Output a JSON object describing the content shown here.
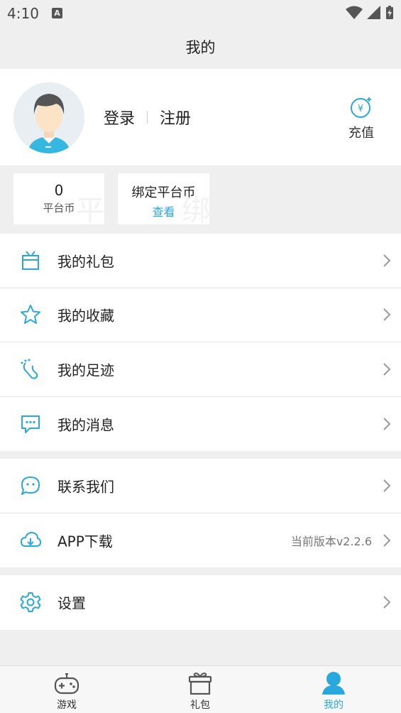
{
  "status_bar": {
    "time": "4:10",
    "notif_letter": "A"
  },
  "header": {
    "title": "我的"
  },
  "profile": {
    "login": "登录",
    "register": "注册",
    "recharge_label": "充值",
    "recharge_symbol": "¥"
  },
  "coins": {
    "platform": {
      "value": "0",
      "label": "平台币"
    },
    "bound": {
      "title": "绑定平台币",
      "link": "查看"
    }
  },
  "menu_group1": [
    {
      "label": "我的礼包",
      "icon": "gift-icon"
    },
    {
      "label": "我的收藏",
      "icon": "star-icon"
    },
    {
      "label": "我的足迹",
      "icon": "footprint-icon"
    },
    {
      "label": "我的消息",
      "icon": "message-icon"
    }
  ],
  "menu_group2": [
    {
      "label": "联系我们",
      "icon": "chat-icon"
    },
    {
      "label": "APP下载",
      "icon": "cloud-download-icon",
      "extra": "当前版本v2.2.6"
    }
  ],
  "menu_group3": [
    {
      "label": "设置",
      "icon": "gear-icon"
    }
  ],
  "bottom_nav": [
    {
      "label": "游戏",
      "icon": "gamepad-icon",
      "active": false
    },
    {
      "label": "礼包",
      "icon": "gift-box-icon",
      "active": false
    },
    {
      "label": "我的",
      "icon": "person-icon",
      "active": true
    }
  ],
  "colors": {
    "accent": "#29a8e0",
    "background": "#efefef"
  }
}
